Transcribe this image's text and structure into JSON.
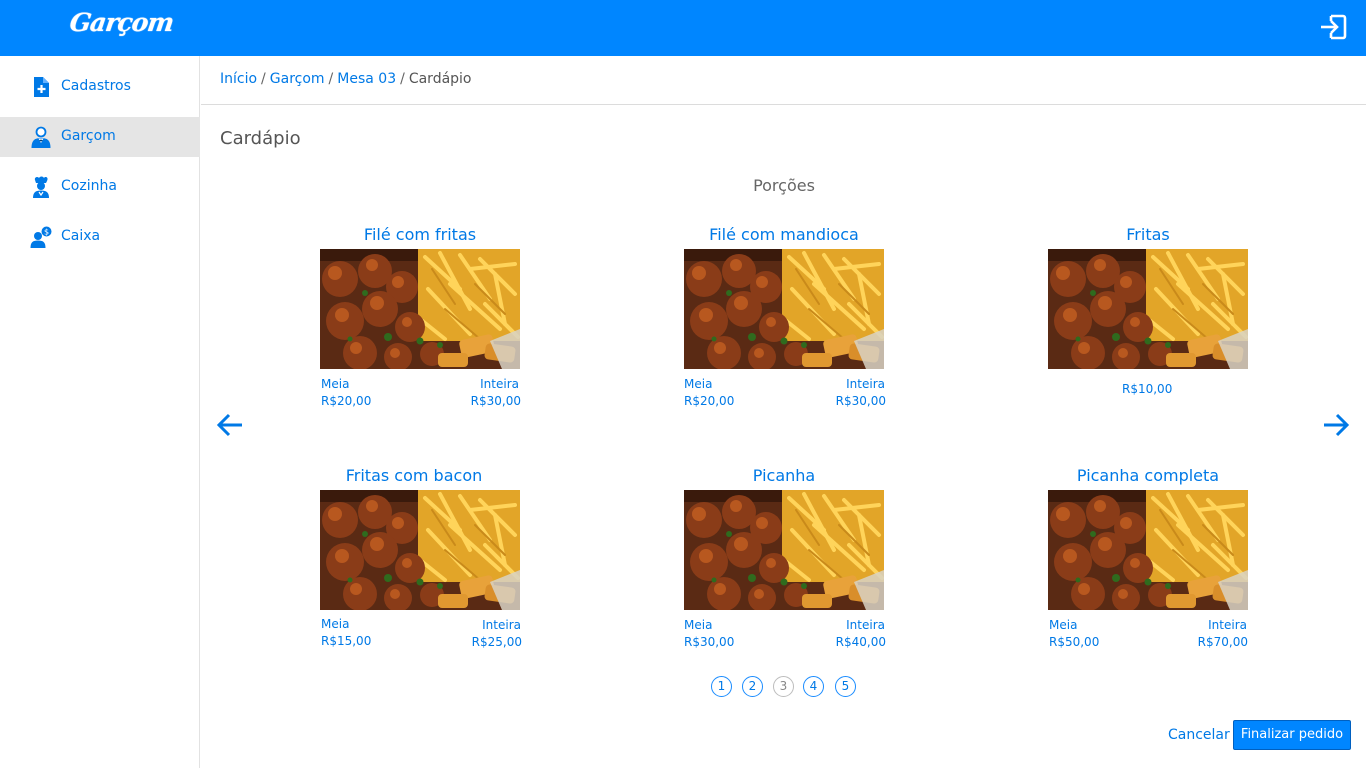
{
  "app": {
    "logo_text": "Garçom"
  },
  "colors": {
    "primary": "#0086ff",
    "link": "#0079e6",
    "active_bg": "#e5e5e5"
  },
  "icons": {
    "logout": "logout-icon"
  },
  "sidebar": {
    "items": [
      {
        "label": "Cadastros",
        "icon": "document-add-icon",
        "active": false
      },
      {
        "label": "Garçom",
        "icon": "waiter-icon",
        "active": true
      },
      {
        "label": "Cozinha",
        "icon": "chef-icon",
        "active": false
      },
      {
        "label": "Caixa",
        "icon": "cashier-icon",
        "active": false
      }
    ]
  },
  "breadcrumb": {
    "items": [
      "Início",
      "Garçom",
      "Mesa 03"
    ],
    "separator": "/",
    "current": "Cardápio"
  },
  "page": {
    "title": "Cardápio",
    "section": "Porções"
  },
  "products": [
    {
      "name": "Filé com fritas",
      "half_label": "Meia",
      "half_price": "R$20,00",
      "full_label": "Inteira",
      "full_price": "R$30,00"
    },
    {
      "name": "Filé com mandioca",
      "half_label": "Meia",
      "half_price": "R$20,00",
      "full_label": "Inteira",
      "full_price": "R$30,00"
    },
    {
      "name": "Fritas",
      "price": "R$10,00"
    },
    {
      "name": "Fritas com bacon",
      "half_label": "Meia",
      "half_price": "R$15,00",
      "full_label": "Inteira",
      "full_price": "R$25,00"
    },
    {
      "name": "Picanha",
      "half_label": "Meia",
      "half_price": "R$30,00",
      "full_label": "Inteira",
      "full_price": "R$40,00"
    },
    {
      "name": "Picanha completa",
      "half_label": "Meia",
      "half_price": "R$50,00",
      "full_label": "Inteira",
      "full_price": "R$70,00"
    }
  ],
  "pagination": {
    "pages": [
      "1",
      "2",
      "3",
      "4",
      "5"
    ],
    "current": "3"
  },
  "actions": {
    "cancel": "Cancelar",
    "finish": "Finalizar pedido"
  }
}
